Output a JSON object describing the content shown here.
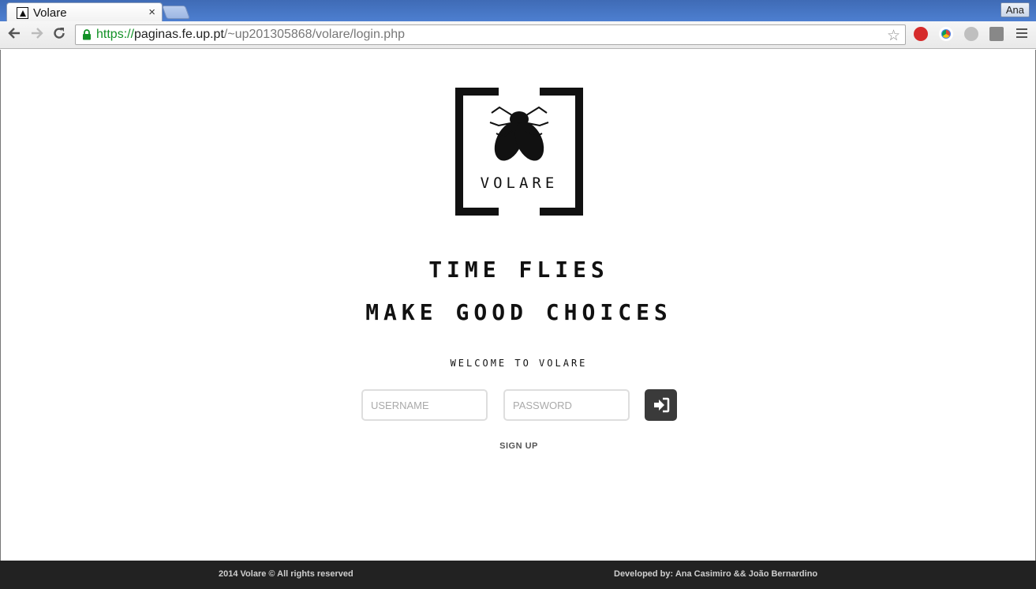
{
  "browser": {
    "tab_title": "Volare",
    "tab_close": "×",
    "profile_name": "Ana",
    "url_scheme": "https://",
    "url_host": "paginas.fe.up.pt",
    "url_path": "/~up201305868/volare/login.php"
  },
  "logo": {
    "text": "VOLARE"
  },
  "hero": {
    "line1": "TIME FLIES",
    "line2": "MAKE GOOD CHOICES",
    "welcome": "WELCOME TO VOLARE"
  },
  "login": {
    "username_placeholder": "USERNAME",
    "password_placeholder": "PASSWORD",
    "signup_label": "SIGN UP"
  },
  "footer": {
    "copyright": "2014 Volare © All rights reserved",
    "credits": "Developed by: Ana Casimiro && João Bernardino"
  },
  "colors": {
    "footer_bg": "#222222",
    "button_bg": "#3a3a3a",
    "url_secure": "#129126"
  }
}
